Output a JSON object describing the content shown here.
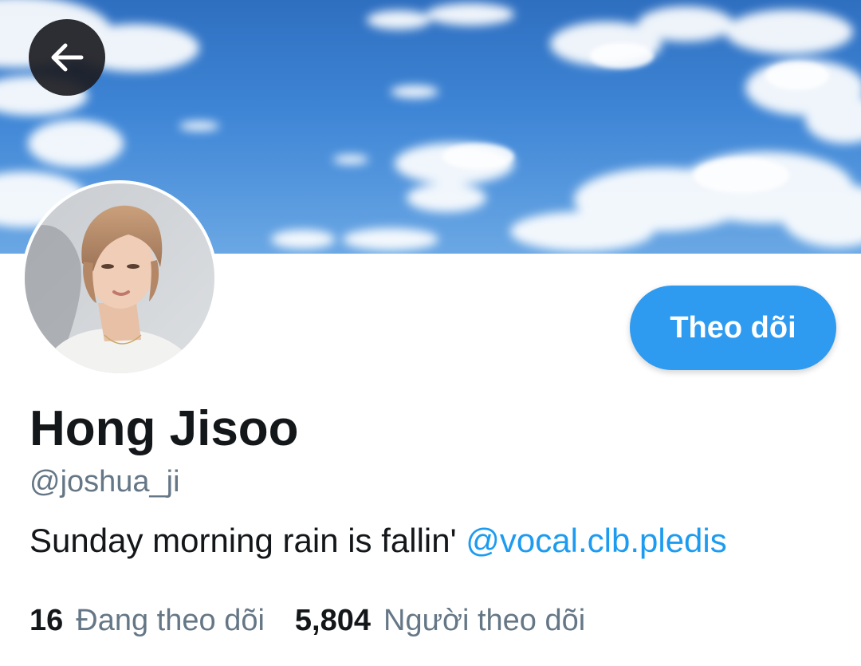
{
  "header": {
    "back_icon": "arrow-left-icon",
    "banner": "sky-with-clouds-image"
  },
  "profile": {
    "avatar": "profile-photo",
    "display_name": "Hong Jisoo",
    "handle": "@joshua_ji",
    "bio_text": "Sunday morning rain is fallin' ",
    "bio_mention": "@vocal.clb.pledis",
    "follow_label": "Theo dõi",
    "following_count": "16",
    "following_label": "Đang theo dõi",
    "followers_count": "5,804",
    "followers_label": "Người theo dõi"
  },
  "colors": {
    "accent": "#2f9bf0",
    "link": "#1d9bf0",
    "text_primary": "#14171a",
    "text_secondary": "#657786"
  }
}
